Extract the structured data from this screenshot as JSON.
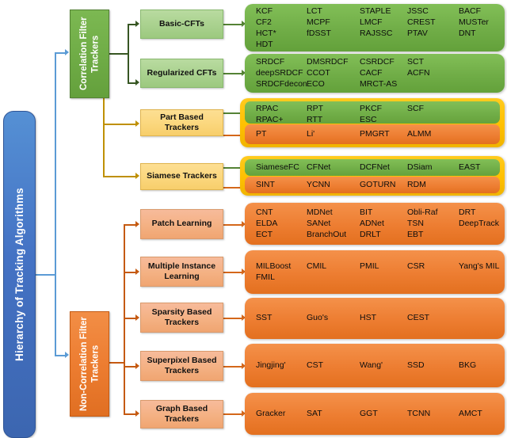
{
  "diagram": {
    "root": {
      "label": "Hierarchy of Tracking Algorithms"
    },
    "branches": [
      {
        "id": "cf",
        "label": "Correlation Filter Trackers"
      },
      {
        "id": "noncf",
        "label": "Non-Correlation Filter Trackers"
      }
    ],
    "categories": [
      {
        "id": "basic-cfts",
        "label": "Basic-CFTs"
      },
      {
        "id": "regularized-cfts",
        "label": "Regularized CFTs"
      },
      {
        "id": "part-based",
        "label": "Part Based Trackers"
      },
      {
        "id": "siamese",
        "label": "Siamese Trackers"
      },
      {
        "id": "patch-learning",
        "label": "Patch Learning"
      },
      {
        "id": "mil",
        "label": "Multiple Instance Learning"
      },
      {
        "id": "sparsity",
        "label": "Sparsity Based Trackers"
      },
      {
        "id": "superpixel",
        "label": "Superpixel Based Trackers"
      },
      {
        "id": "graph",
        "label": "Graph Based Trackers"
      }
    ],
    "panels": {
      "basic_cfts": {
        "rows": [
          [
            "KCF",
            "LCT",
            "STAPLE",
            "JSSC",
            "BACF"
          ],
          [
            "CF2",
            "MCPF",
            "LMCF",
            "CREST",
            "MUSTer"
          ],
          [
            "HCT*",
            "fDSST",
            "RAJSSC",
            "PTAV",
            "DNT"
          ],
          [
            "HDT",
            "",
            "",
            "",
            ""
          ]
        ]
      },
      "regularized_cfts": {
        "rows": [
          [
            "SRDCF",
            "DMSRDCF",
            "CSRDCF",
            "SCT",
            ""
          ],
          [
            "deepSRDCF",
            "CCOT",
            "CACF",
            "ACFN",
            ""
          ],
          [
            "SRDCFdecon",
            "ECO",
            "MRCT-AS",
            "",
            ""
          ]
        ]
      },
      "part_based_green": {
        "rows": [
          [
            "RPAC",
            "RPT",
            "PKCF",
            "SCF",
            ""
          ],
          [
            "RPAC+",
            "RTT",
            "ESC",
            "",
            ""
          ]
        ]
      },
      "part_based_orange": {
        "rows": [
          [
            "PT",
            "Li'",
            "PMGRT",
            "ALMM",
            ""
          ]
        ]
      },
      "siamese_green": {
        "rows": [
          [
            "SiameseFC",
            "CFNet",
            "DCFNet",
            "DSiam",
            "EAST"
          ]
        ]
      },
      "siamese_orange": {
        "rows": [
          [
            "SINT",
            "YCNN",
            "GOTURN",
            "RDM",
            ""
          ]
        ]
      },
      "patch_learning": {
        "rows": [
          [
            "CNT",
            "MDNet",
            "BIT",
            "Obli-Raf",
            "DRT"
          ],
          [
            "ELDA",
            "SANet",
            "ADNet",
            "TSN",
            "DeepTrack"
          ],
          [
            "ECT",
            "BranchOut",
            "DRLT",
            "EBT",
            ""
          ]
        ]
      },
      "mil": {
        "rows": [
          [
            "MILBoost",
            "CMIL",
            "PMIL",
            "CSR",
            "Yang's MIL"
          ],
          [
            "FMIL",
            "",
            "",
            "",
            ""
          ]
        ]
      },
      "sparsity": {
        "rows": [
          [
            "SST",
            "Guo's",
            "HST",
            "CEST",
            ""
          ]
        ]
      },
      "superpixel": {
        "rows": [
          [
            "Jingjing'",
            "CST",
            "Wang'",
            "SSD",
            "BKG"
          ]
        ]
      },
      "graph": {
        "rows": [
          [
            "Gracker",
            "SAT",
            "GGT",
            "TCNN",
            "AMCT"
          ]
        ]
      }
    },
    "colors": {
      "root_blue": "#4472c4",
      "green": "#70ad47",
      "orange": "#ed7d31",
      "yellow": "#ffc000",
      "light_green": "#a9d18e",
      "light_yellow": "#fbd77d",
      "light_orange": "#f4b183",
      "dark_green_line": "#375623",
      "dark_yellow_line": "#bf9000",
      "dark_orange_line": "#c55a11",
      "blue_line": "#5b9bd5"
    }
  }
}
